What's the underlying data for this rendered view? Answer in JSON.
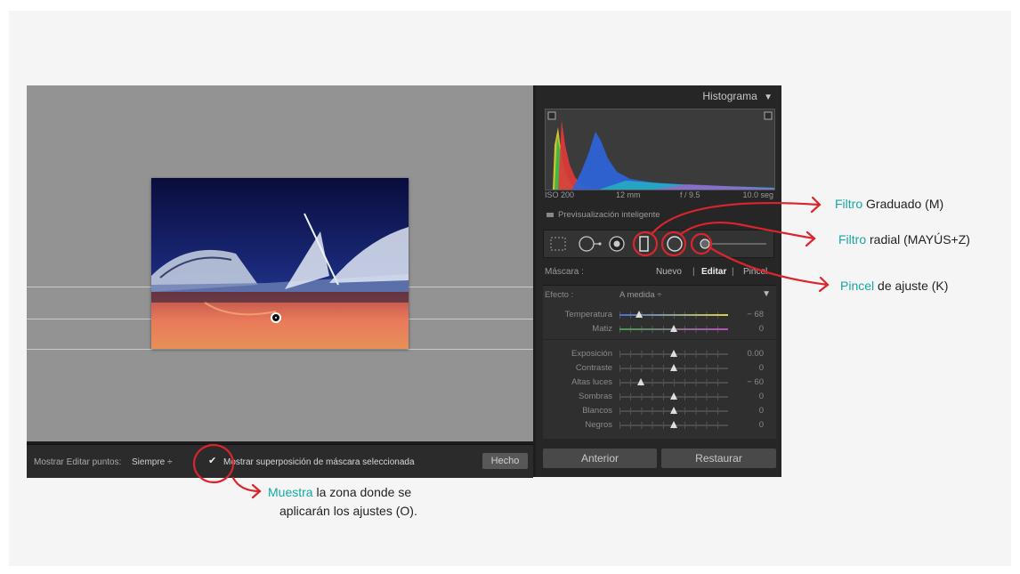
{
  "histogram": {
    "title": "Histograma",
    "iso": "ISO 200",
    "focal": "12 mm",
    "aperture": "f / 9.5",
    "shutter": "10.0 seg",
    "preview_label": "Previsualización inteligente"
  },
  "mask_bar": {
    "label": "Máscara :",
    "new": "Nuevo",
    "edit": "Editar",
    "brush": "Pincel"
  },
  "effect": {
    "label": "Efecto :",
    "value": "A medida ÷"
  },
  "sliders": [
    {
      "label": "Temperatura",
      "value": "− 68",
      "position": 0.18
    },
    {
      "label": "Matiz",
      "value": "0",
      "position": 0.5
    },
    {
      "label": "Exposición",
      "value": "0.00",
      "position": 0.5
    },
    {
      "label": "Contraste",
      "value": "0",
      "position": 0.5
    },
    {
      "label": "Altas luces",
      "value": "− 60",
      "position": 0.2
    },
    {
      "label": "Sombras",
      "value": "0",
      "position": 0.5
    },
    {
      "label": "Blancos",
      "value": "0",
      "position": 0.5
    },
    {
      "label": "Negros",
      "value": "0",
      "position": 0.5
    }
  ],
  "bottom_buttons": {
    "previous": "Anterior",
    "reset": "Restaurar"
  },
  "toolbar": {
    "show_points_label": "Mostrar Editar puntos:",
    "show_points_value": "Siempre ÷",
    "overlay_label": "Mostrar superposición de máscara seleccionada",
    "overlay_checked": true,
    "done": "Hecho"
  },
  "annotations": {
    "graduated_kw": "Filtro",
    "graduated_rest": "Graduado (M)",
    "radial_kw": "Filtro",
    "radial_rest": "radial (MAYÚS+Z)",
    "brush_kw": "Pincel",
    "brush_rest": "de ajuste (K)",
    "overlay_kw": "Muestra",
    "overlay_rest": "la zona donde se",
    "overlay_line2": "aplicarán los ajustes (O)."
  },
  "colors": {
    "annotation_red": "#d9252b",
    "annotation_teal": "#18a6a6",
    "panel_bg": "#262626",
    "canvas_bg": "#939393"
  }
}
